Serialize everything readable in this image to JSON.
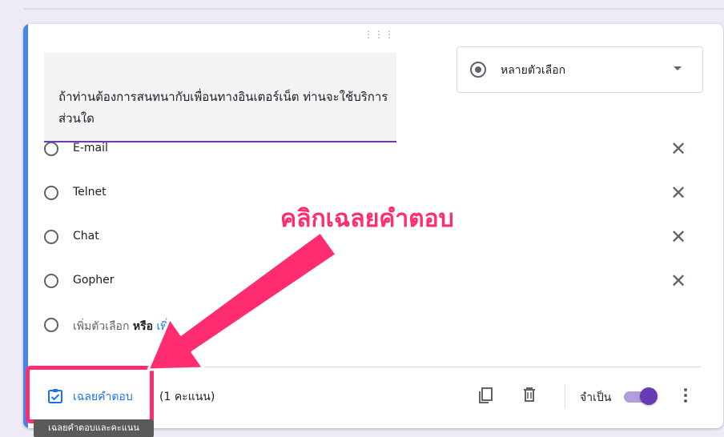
{
  "question": {
    "text": "ถ้าท่านต้องการสนทนากับเพื่อนทางอินเตอร์เน็ต ท่านจะใช้บริการส่วนใด",
    "type_label": "หลายตัวเลือก"
  },
  "options": [
    {
      "label": "E-mail"
    },
    {
      "label": "Telnet"
    },
    {
      "label": "Chat"
    },
    {
      "label": "Gopher"
    }
  ],
  "add_option": {
    "label": "เพิ่มตัวเลือก",
    "or": "หรือ",
    "other": "เพิ่ม"
  },
  "footer": {
    "answer_key_label": "เฉลยคำตอบ",
    "points_label": "(1 คะแนน)",
    "required_label": "จำเป็น",
    "required_on": true
  },
  "tooltip": "เฉลยคำตอบและคะแนน",
  "annotation": {
    "text": "คลิกเฉลยคำตอบ",
    "color": "#ff2d6f"
  },
  "colors": {
    "accent": "#4285f4",
    "primary": "#673ab7",
    "link": "#1a73e8"
  },
  "icons": [
    "drag-handle-icon",
    "radio-selected-icon",
    "dropdown-caret-icon",
    "close-icon",
    "answer-key-check-icon",
    "copy-icon",
    "trash-icon",
    "more-vert-icon"
  ]
}
